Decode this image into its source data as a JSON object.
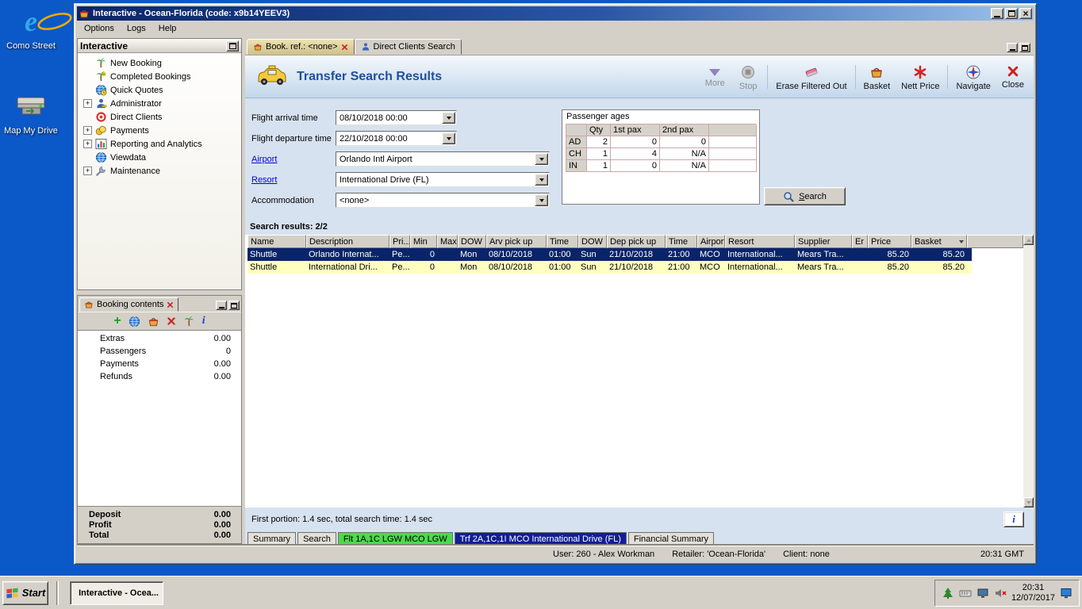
{
  "icons": {
    "plus_glyph": "+",
    "close_glyph": "×",
    "info_glyph": "i",
    "ie_glyph": "e"
  },
  "desktop": {
    "icons": [
      {
        "label": "Como Street"
      },
      {
        "label": "Map My Drive"
      }
    ]
  },
  "window": {
    "title": "Interactive - Ocean-Florida (code: x9b14YEEV3)",
    "menu": [
      {
        "label": "Options"
      },
      {
        "label": "Logs"
      },
      {
        "label": "Help"
      }
    ]
  },
  "sidebar": {
    "title": "Interactive",
    "items": [
      {
        "label": "New Booking"
      },
      {
        "label": "Completed Bookings"
      },
      {
        "label": "Quick Quotes"
      },
      {
        "label": "Administrator"
      },
      {
        "label": "Direct Clients"
      },
      {
        "label": "Payments"
      },
      {
        "label": "Reporting and Analytics"
      },
      {
        "label": "Viewdata"
      },
      {
        "label": "Maintenance"
      }
    ]
  },
  "booking_contents": {
    "tab": "Booking contents",
    "rows": [
      {
        "label": "Extras",
        "value": "0.00"
      },
      {
        "label": "Passengers",
        "value": "0"
      },
      {
        "label": "Payments",
        "value": "0.00"
      },
      {
        "label": "Refunds",
        "value": "0.00"
      }
    ],
    "totals": [
      {
        "label": "Deposit",
        "value": "0.00"
      },
      {
        "label": "Profit",
        "value": "0.00"
      },
      {
        "label": "Total",
        "value": "0.00"
      }
    ]
  },
  "main": {
    "tabs": [
      {
        "label": "Book. ref.: <none>"
      },
      {
        "label": "Direct Clients Search"
      }
    ],
    "title": "Transfer Search Results",
    "toolbar": [
      {
        "label": "More"
      },
      {
        "label": "Stop"
      },
      {
        "label": "Erase Filtered Out"
      },
      {
        "label": "Basket"
      },
      {
        "label": "Nett Price"
      },
      {
        "label": "Navigate"
      },
      {
        "label": "Close"
      }
    ],
    "form": {
      "arrival_label": "Flight arrival time",
      "arrival_value": "08/10/2018 00:00",
      "departure_label": "Flight departure time",
      "departure_value": "22/10/2018 00:00",
      "airport_label": "Airport",
      "airport_value": "Orlando Intl Airport",
      "resort_label": "Resort",
      "resort_value": "International Drive (FL)",
      "accommodation_label": "Accommodation",
      "accommodation_value": "<none>"
    },
    "passenger_ages": {
      "title": "Passenger ages",
      "headers": [
        "Qty",
        "1st pax",
        "2nd pax"
      ],
      "rows": [
        {
          "type": "AD",
          "qty": "2",
          "pax1": "0",
          "pax2": "0"
        },
        {
          "type": "CH",
          "qty": "1",
          "pax1": "4",
          "pax2": "N/A"
        },
        {
          "type": "IN",
          "qty": "1",
          "pax1": "0",
          "pax2": "N/A"
        }
      ]
    },
    "search_button": "Search",
    "results_label": "Search results: 2/2",
    "results": {
      "columns": [
        "Name",
        "Description",
        "Pri...",
        "Min",
        "Max",
        "DOW",
        "Arv pick up",
        "Time",
        "DOW",
        "Dep pick up",
        "Time",
        "Airport",
        "Resort",
        "Supplier",
        "Er",
        "Price",
        "Basket"
      ],
      "rows": [
        [
          "Shuttle",
          "Orlando Internat...",
          "Pe...",
          "0",
          "",
          "Mon",
          "08/10/2018",
          "01:00",
          "Sun",
          "21/10/2018",
          "21:00",
          "MCO",
          "International...",
          "Mears Tra...",
          "",
          "85.20",
          "85.20"
        ],
        [
          "Shuttle",
          "International Dri...",
          "Pe...",
          "0",
          "",
          "Mon",
          "08/10/2018",
          "01:00",
          "Sun",
          "21/10/2018",
          "21:00",
          "MCO",
          "International...",
          "Mears Tra...",
          "",
          "85.20",
          "85.20"
        ]
      ]
    },
    "timing": "First portion: 1.4 sec, total search time: 1.4 sec",
    "bottom_tabs": [
      {
        "label": "Summary"
      },
      {
        "label": "Search"
      },
      {
        "label": "Flt 1A,1C LGW MCO LGW"
      },
      {
        "label": "Trf 2A,1C,1I MCO International Drive (FL)"
      },
      {
        "label": "Financial Summary"
      }
    ],
    "status": {
      "user": "User: 260 - Alex Workman",
      "retailer": "Retailer: 'Ocean-Florida'",
      "client": "Client: none",
      "time": "20:31 GMT"
    }
  },
  "taskbar": {
    "start_label": "Start",
    "task_label": "Interactive - Ocea...",
    "clock_time": "20:31",
    "clock_date": "12/07/2017"
  }
}
